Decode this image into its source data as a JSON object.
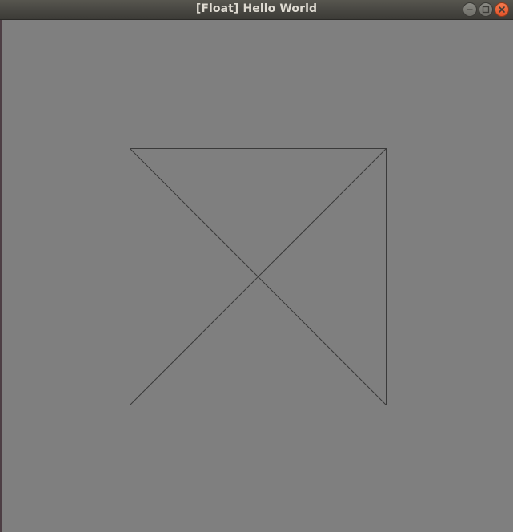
{
  "window": {
    "title": "[Float] Hello World",
    "controls": {
      "minimize_icon": "minimize-icon",
      "maximize_icon": "maximize-icon",
      "close_icon": "close-icon"
    }
  },
  "canvas": {
    "background_color": "#7f7f7f",
    "line_color": "#3a3a3a"
  }
}
